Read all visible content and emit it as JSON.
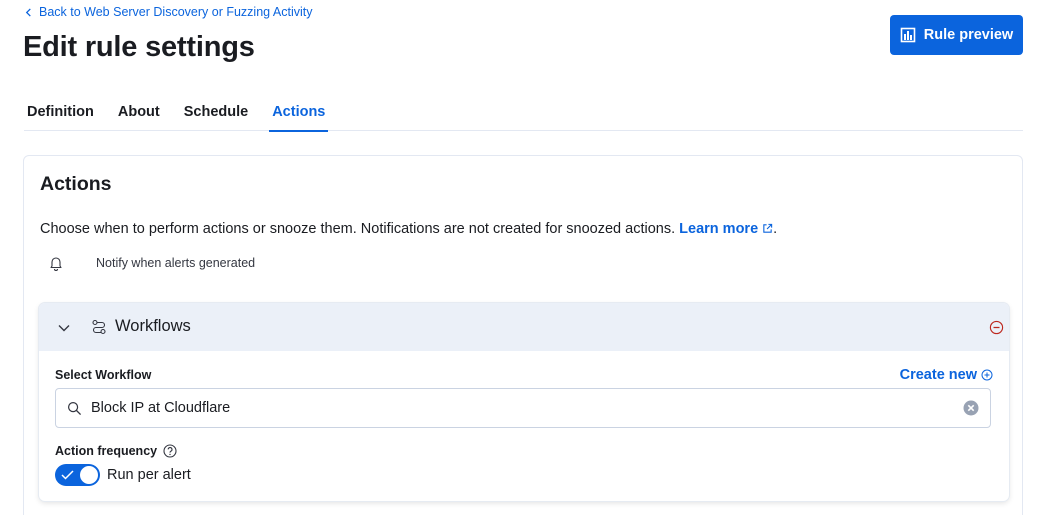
{
  "header": {
    "back_link": "Back to Web Server Discovery or Fuzzing Activity",
    "title": "Edit rule settings",
    "preview_button": "Rule preview"
  },
  "tabs": [
    {
      "label": "Definition",
      "active": false
    },
    {
      "label": "About",
      "active": false
    },
    {
      "label": "Schedule",
      "active": false
    },
    {
      "label": "Actions",
      "active": true
    }
  ],
  "actions_panel": {
    "title": "Actions",
    "description": "Choose when to perform actions or snooze them. Notifications are not created for snoozed actions.",
    "learn_more": "Learn more",
    "description_end": ".",
    "notify_text": "Notify when alerts generated"
  },
  "workflow_card": {
    "title": "Workflows",
    "select_label": "Select Workflow",
    "create_new": "Create new",
    "selected_value": "Block IP at Cloudflare",
    "frequency_label": "Action frequency",
    "toggle_label": "Run per alert",
    "toggle_on": true
  },
  "icons": {
    "back": "chevron-left-icon",
    "preview": "chart-icon",
    "external": "external-link-icon",
    "notify": "bell-icon",
    "collapse": "chevron-down-icon",
    "workflow": "workflow-icon",
    "remove": "minus-circle-icon",
    "create": "plus-circle-icon",
    "search": "search-icon",
    "clear": "clear-icon",
    "help": "question-icon"
  },
  "colors": {
    "primary": "#0b64dd",
    "text": "#1a1c21",
    "header_bg": "#ebf0f8",
    "danger": "#bd271e"
  }
}
